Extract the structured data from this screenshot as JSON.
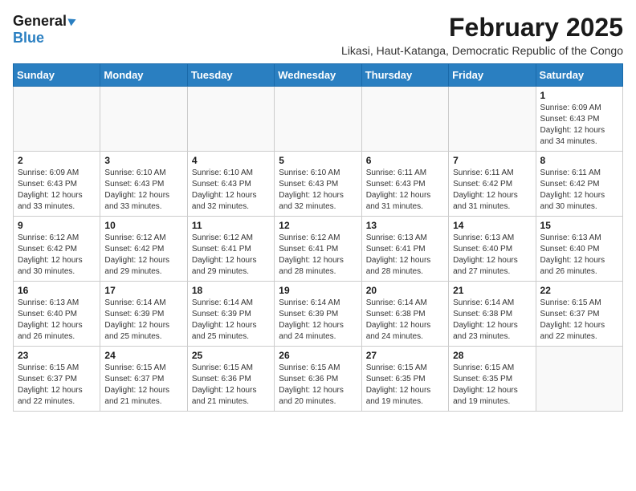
{
  "header": {
    "logo_general": "General",
    "logo_blue": "Blue",
    "main_title": "February 2025",
    "subtitle": "Likasi, Haut-Katanga, Democratic Republic of the Congo"
  },
  "calendar": {
    "weekdays": [
      "Sunday",
      "Monday",
      "Tuesday",
      "Wednesday",
      "Thursday",
      "Friday",
      "Saturday"
    ],
    "weeks": [
      [
        {
          "day": "",
          "info": ""
        },
        {
          "day": "",
          "info": ""
        },
        {
          "day": "",
          "info": ""
        },
        {
          "day": "",
          "info": ""
        },
        {
          "day": "",
          "info": ""
        },
        {
          "day": "",
          "info": ""
        },
        {
          "day": "1",
          "info": "Sunrise: 6:09 AM\nSunset: 6:43 PM\nDaylight: 12 hours\nand 34 minutes."
        }
      ],
      [
        {
          "day": "2",
          "info": "Sunrise: 6:09 AM\nSunset: 6:43 PM\nDaylight: 12 hours\nand 33 minutes."
        },
        {
          "day": "3",
          "info": "Sunrise: 6:10 AM\nSunset: 6:43 PM\nDaylight: 12 hours\nand 33 minutes."
        },
        {
          "day": "4",
          "info": "Sunrise: 6:10 AM\nSunset: 6:43 PM\nDaylight: 12 hours\nand 32 minutes."
        },
        {
          "day": "5",
          "info": "Sunrise: 6:10 AM\nSunset: 6:43 PM\nDaylight: 12 hours\nand 32 minutes."
        },
        {
          "day": "6",
          "info": "Sunrise: 6:11 AM\nSunset: 6:43 PM\nDaylight: 12 hours\nand 31 minutes."
        },
        {
          "day": "7",
          "info": "Sunrise: 6:11 AM\nSunset: 6:42 PM\nDaylight: 12 hours\nand 31 minutes."
        },
        {
          "day": "8",
          "info": "Sunrise: 6:11 AM\nSunset: 6:42 PM\nDaylight: 12 hours\nand 30 minutes."
        }
      ],
      [
        {
          "day": "9",
          "info": "Sunrise: 6:12 AM\nSunset: 6:42 PM\nDaylight: 12 hours\nand 30 minutes."
        },
        {
          "day": "10",
          "info": "Sunrise: 6:12 AM\nSunset: 6:42 PM\nDaylight: 12 hours\nand 29 minutes."
        },
        {
          "day": "11",
          "info": "Sunrise: 6:12 AM\nSunset: 6:41 PM\nDaylight: 12 hours\nand 29 minutes."
        },
        {
          "day": "12",
          "info": "Sunrise: 6:12 AM\nSunset: 6:41 PM\nDaylight: 12 hours\nand 28 minutes."
        },
        {
          "day": "13",
          "info": "Sunrise: 6:13 AM\nSunset: 6:41 PM\nDaylight: 12 hours\nand 28 minutes."
        },
        {
          "day": "14",
          "info": "Sunrise: 6:13 AM\nSunset: 6:40 PM\nDaylight: 12 hours\nand 27 minutes."
        },
        {
          "day": "15",
          "info": "Sunrise: 6:13 AM\nSunset: 6:40 PM\nDaylight: 12 hours\nand 26 minutes."
        }
      ],
      [
        {
          "day": "16",
          "info": "Sunrise: 6:13 AM\nSunset: 6:40 PM\nDaylight: 12 hours\nand 26 minutes."
        },
        {
          "day": "17",
          "info": "Sunrise: 6:14 AM\nSunset: 6:39 PM\nDaylight: 12 hours\nand 25 minutes."
        },
        {
          "day": "18",
          "info": "Sunrise: 6:14 AM\nSunset: 6:39 PM\nDaylight: 12 hours\nand 25 minutes."
        },
        {
          "day": "19",
          "info": "Sunrise: 6:14 AM\nSunset: 6:39 PM\nDaylight: 12 hours\nand 24 minutes."
        },
        {
          "day": "20",
          "info": "Sunrise: 6:14 AM\nSunset: 6:38 PM\nDaylight: 12 hours\nand 24 minutes."
        },
        {
          "day": "21",
          "info": "Sunrise: 6:14 AM\nSunset: 6:38 PM\nDaylight: 12 hours\nand 23 minutes."
        },
        {
          "day": "22",
          "info": "Sunrise: 6:15 AM\nSunset: 6:37 PM\nDaylight: 12 hours\nand 22 minutes."
        }
      ],
      [
        {
          "day": "23",
          "info": "Sunrise: 6:15 AM\nSunset: 6:37 PM\nDaylight: 12 hours\nand 22 minutes."
        },
        {
          "day": "24",
          "info": "Sunrise: 6:15 AM\nSunset: 6:37 PM\nDaylight: 12 hours\nand 21 minutes."
        },
        {
          "day": "25",
          "info": "Sunrise: 6:15 AM\nSunset: 6:36 PM\nDaylight: 12 hours\nand 21 minutes."
        },
        {
          "day": "26",
          "info": "Sunrise: 6:15 AM\nSunset: 6:36 PM\nDaylight: 12 hours\nand 20 minutes."
        },
        {
          "day": "27",
          "info": "Sunrise: 6:15 AM\nSunset: 6:35 PM\nDaylight: 12 hours\nand 19 minutes."
        },
        {
          "day": "28",
          "info": "Sunrise: 6:15 AM\nSunset: 6:35 PM\nDaylight: 12 hours\nand 19 minutes."
        },
        {
          "day": "",
          "info": ""
        }
      ]
    ]
  }
}
